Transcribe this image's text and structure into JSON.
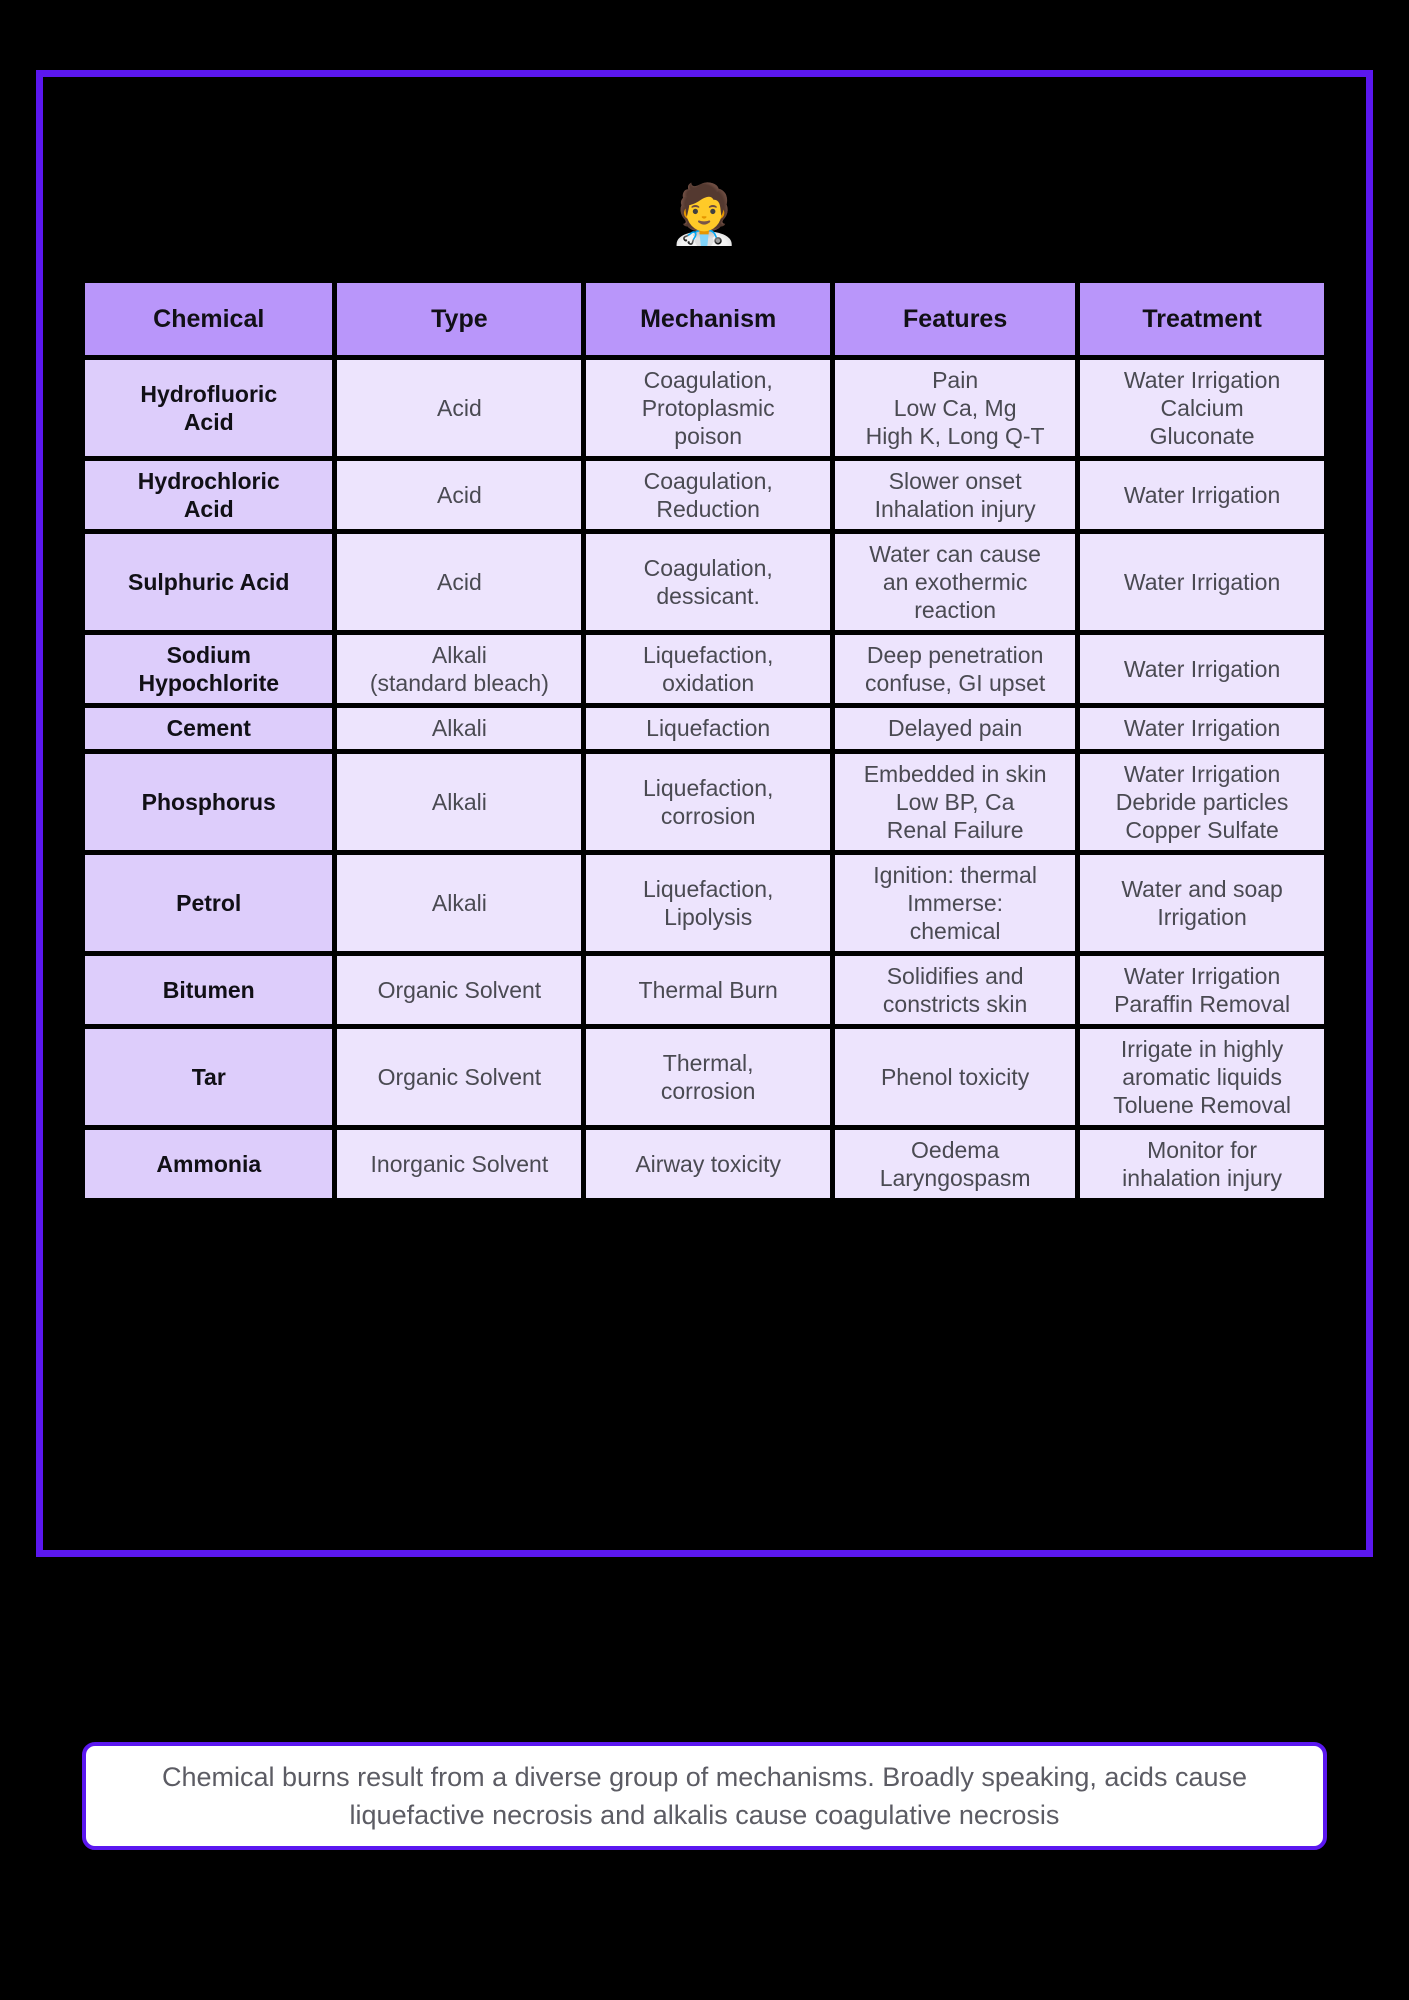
{
  "avatar": {
    "icon": "doctor-face-emoji",
    "glyph": "🧑‍⚕️"
  },
  "table": {
    "headers": [
      "Chemical",
      "Type",
      "Mechanism",
      "Features",
      "Treatment"
    ],
    "rows": [
      {
        "chemical": "Hydrofluoric\nAcid",
        "type": "Acid",
        "mechanism": "Coagulation,\nProtoplasmic\npoison",
        "features": "Pain\nLow Ca, Mg\nHigh K, Long Q-T",
        "treatment": "Water Irrigation\nCalcium\nGluconate"
      },
      {
        "chemical": "Hydrochloric\nAcid",
        "type": "Acid",
        "mechanism": "Coagulation,\nReduction",
        "features": "Slower onset\nInhalation injury",
        "treatment": "Water Irrigation"
      },
      {
        "chemical": "Sulphuric Acid",
        "type": "Acid",
        "mechanism": "Coagulation,\ndessicant.",
        "features": "Water can cause\nan exothermic\nreaction",
        "treatment": "Water Irrigation"
      },
      {
        "chemical": "Sodium\nHypochlorite",
        "type": "Alkali\n(standard bleach)",
        "mechanism": "Liquefaction,\noxidation",
        "features": "Deep penetration\nconfuse, GI upset",
        "treatment": "Water Irrigation"
      },
      {
        "chemical": "Cement",
        "type": "Alkali",
        "mechanism": "Liquefaction",
        "features": "Delayed pain",
        "treatment": "Water Irrigation"
      },
      {
        "chemical": "Phosphorus",
        "type": "Alkali",
        "mechanism": "Liquefaction,\ncorrosion",
        "features": "Embedded in skin\nLow BP, Ca\nRenal Failure",
        "treatment": "Water Irrigation\nDebride particles\nCopper Sulfate"
      },
      {
        "chemical": "Petrol",
        "type": "Alkali",
        "mechanism": "Liquefaction,\nLipolysis",
        "features": "Ignition: thermal\nImmerse:\nchemical",
        "treatment": "Water and soap\nIrrigation"
      },
      {
        "chemical": "Bitumen",
        "type": "Organic Solvent",
        "mechanism": "Thermal Burn",
        "features": "Solidifies and\nconstricts skin",
        "treatment": "Water Irrigation\nParaffin Removal"
      },
      {
        "chemical": "Tar",
        "type": "Organic Solvent",
        "mechanism": "Thermal,\ncorrosion",
        "features": "Phenol toxicity",
        "treatment": "Irrigate in highly\naromatic liquids\nToluene Removal"
      },
      {
        "chemical": "Ammonia",
        "type": "Inorganic Solvent",
        "mechanism": "Airway toxicity",
        "features": "Oedema\nLaryngospasm",
        "treatment": "Monitor for\ninhalation injury"
      }
    ]
  },
  "footnote": {
    "text": "Chemical burns result from a diverse group of mechanisms. Broadly speaking, acids cause liquefactive necrosis and alkalis cause coagulative necrosis"
  },
  "colors": {
    "background": "#000000",
    "frame_border": "#5B17F0",
    "header_fill": "#B996FA",
    "chemical_fill": "#DDCDFB",
    "data_fill": "#EDE4FD",
    "footnote_border": "#5B17F0",
    "footnote_fill": "#FFFFFF"
  }
}
